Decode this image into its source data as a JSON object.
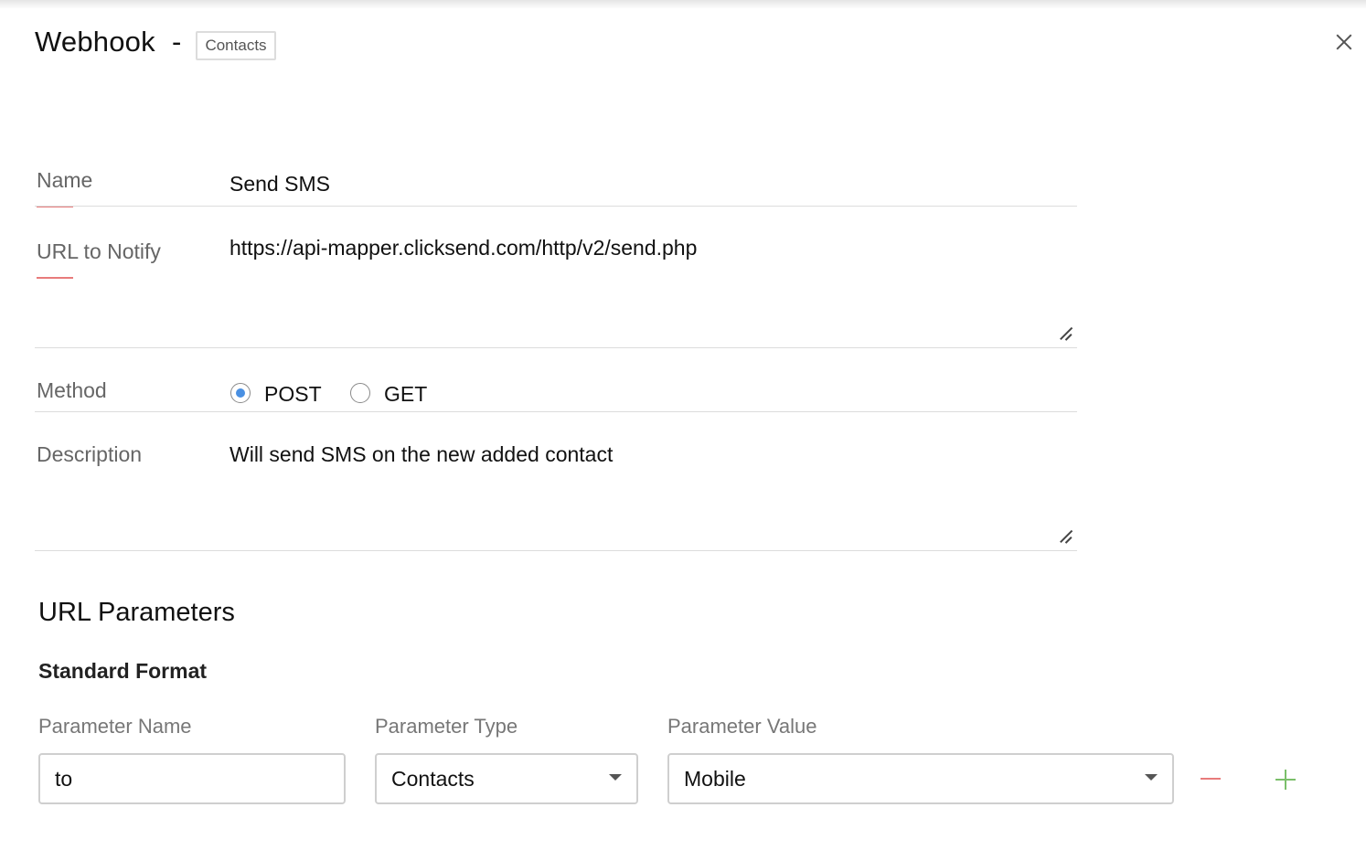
{
  "header": {
    "title": "Webhook",
    "separator": "-",
    "module_badge": "Contacts",
    "close_icon": "close-icon"
  },
  "form": {
    "name": {
      "label": "Name",
      "value": "Send SMS",
      "required": true
    },
    "url": {
      "label": "URL to Notify",
      "value": "https://api-mapper.clicksend.com/http/v2/send.php",
      "required": true
    },
    "method": {
      "label": "Method",
      "options": [
        {
          "label": "POST",
          "selected": true
        },
        {
          "label": "GET",
          "selected": false
        }
      ]
    },
    "description": {
      "label": "Description",
      "value": "Will send SMS on the new added contact"
    }
  },
  "url_parameters": {
    "title": "URL Parameters",
    "format_title": "Standard Format",
    "columns": {
      "name": "Parameter Name",
      "type": "Parameter Type",
      "value": "Parameter Value"
    },
    "rows": [
      {
        "name": "to",
        "type": "Contacts",
        "value": "Mobile"
      }
    ],
    "remove_icon": "minus-icon",
    "add_icon": "plus-icon"
  },
  "colors": {
    "required_marker": "#e87b7b",
    "radio_selected": "#4a90e2",
    "add_button": "#7bbf6a",
    "remove_button": "#e87b7b"
  }
}
